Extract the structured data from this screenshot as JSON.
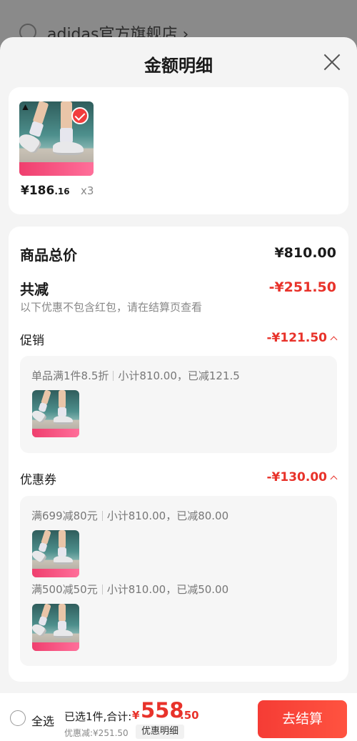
{
  "background": {
    "store_name": "adidas官方旗舰店 ›"
  },
  "sheet": {
    "title": "金额明细"
  },
  "product": {
    "price_int": "¥186",
    "price_dec": ".16",
    "quantity": "x3"
  },
  "summary": {
    "total_label": "商品总价",
    "total_value": "¥810.00",
    "discount_label": "共减",
    "discount_value": "-¥251.50",
    "note": "以下优惠不包含红包，请在结算页查看"
  },
  "promotion": {
    "label": "促销",
    "value": "-¥121.50",
    "rule": {
      "name": "单品满1件8.5折",
      "detail": "小计810.00，已减121.5"
    }
  },
  "coupons": {
    "label": "优惠券",
    "value": "-¥130.00",
    "rules": [
      {
        "name": "满699减80元",
        "detail": "小计810.00，已减80.00"
      },
      {
        "name": "满500减50元",
        "detail": "小计810.00，已减50.00"
      }
    ]
  },
  "bottom_bar": {
    "select_all": "全选",
    "selected_label": "已选1件,合计:",
    "currency": "¥",
    "total_int": "558",
    "total_dec": ".50",
    "discount_text": "优惠减:¥251.50",
    "detail_button": "优惠明细",
    "checkout_button": "去结算"
  },
  "colors": {
    "accent_red": "#e8322a",
    "checkout_red": "#f53c35"
  }
}
